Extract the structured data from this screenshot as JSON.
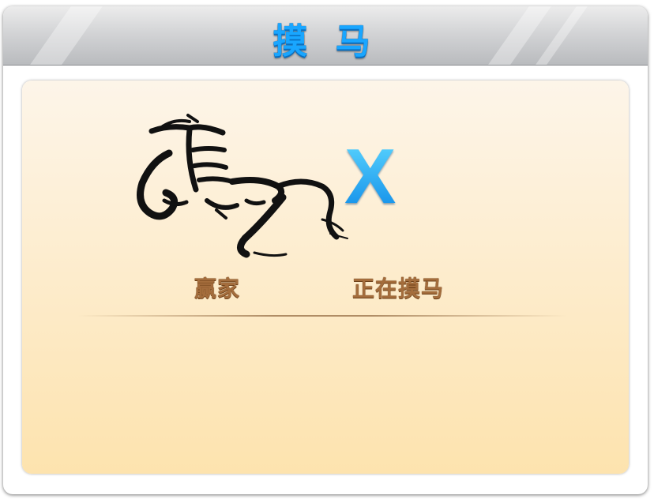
{
  "dialog": {
    "title": "摸 马",
    "title_color": "#19a6ff"
  },
  "content": {
    "logo_icon": "horse-calligraphy-icon",
    "close_mark": "X",
    "close_mark_color": "#19aef8",
    "winner_label": "赢家",
    "status_text": "正在摸马",
    "label_color": "#a46d3c",
    "panel_colors": [
      "#fdf5e9",
      "#fde3ae"
    ]
  }
}
